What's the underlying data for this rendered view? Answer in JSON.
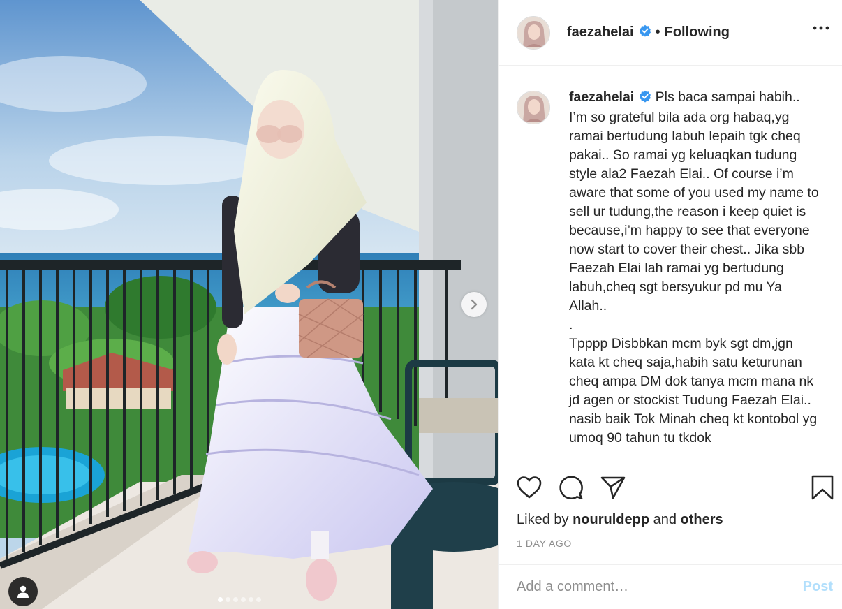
{
  "header": {
    "username": "faezahelai",
    "separator": "•",
    "follow_status": "Following",
    "more_icon": "more-horizontal-icon"
  },
  "caption": {
    "username": "faezahelai",
    "text": "Pls baca sampai habih..\nI’m so grateful bila ada org habaq,yg ramai bertudung labuh lepaih tgk cheq pakai.. So ramai yg keluaqkan tudung style ala2 Faezah Elai.. Of course i’m aware that some of you used my name to sell ur tudung,the reason i keep quiet is because,i’m happy to see that everyone now start to cover their chest.. Jika sbb Faezah Elai lah ramai yg bertudung labuh,cheq sgt bersyukur pd mu Ya Allah..\n.\nTpppp Disbbkan mcm byk sgt dm,jgn kata kt cheq saja,habih satu keturunan cheq ampa DM dok tanya mcm mana nk jd agen or stockist Tudung Faezah Elai.. nasib baik Tok Minah cheq kt kontobol yg umoq 90 tahun tu tkdok"
  },
  "actions": {
    "like_icon": "heart-icon",
    "comment_icon": "comment-icon",
    "share_icon": "paper-plane-icon",
    "save_icon": "bookmark-icon"
  },
  "likes": {
    "prefix": "Liked by",
    "user": "nouruldepp",
    "conjunction": "and",
    "others": "others"
  },
  "timestamp": "1 DAY AGO",
  "comment": {
    "placeholder": "Add a comment…",
    "post_label": "Post"
  },
  "carousel": {
    "total_slides": 6,
    "current_slide": 1,
    "next_icon": "chevron-right-icon",
    "tag_icon": "user-tag-icon"
  },
  "colors": {
    "verified": "#3897f0",
    "post_button_disabled": "#b2dffc",
    "muted_text": "#8e8e8e"
  }
}
